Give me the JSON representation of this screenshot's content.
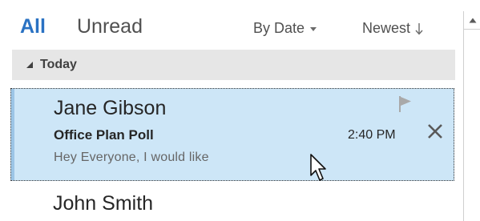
{
  "filters": {
    "all": "All",
    "unread": "Unread",
    "sort_by": "By Date",
    "sort_order": "Newest"
  },
  "group": {
    "label": "Today"
  },
  "messages": [
    {
      "sender": "Jane Gibson",
      "subject": "Office Plan Poll",
      "preview": "Hey Everyone,   I would like",
      "time": "2:40 PM",
      "selected": true
    },
    {
      "sender": "John Smith",
      "selected": false
    }
  ],
  "colors": {
    "accent": "#2a72c3",
    "selected_bg": "#cde6f7",
    "group_bg": "#e6e6e6"
  },
  "icons": {
    "flag": "flag-icon",
    "delete": "close-icon",
    "sort_caret": "caret-down-icon",
    "sort_arrow": "arrow-down-icon",
    "group_toggle": "triangle-collapse-icon",
    "scroll_up": "scroll-up-icon",
    "cursor": "mouse-pointer-icon"
  }
}
